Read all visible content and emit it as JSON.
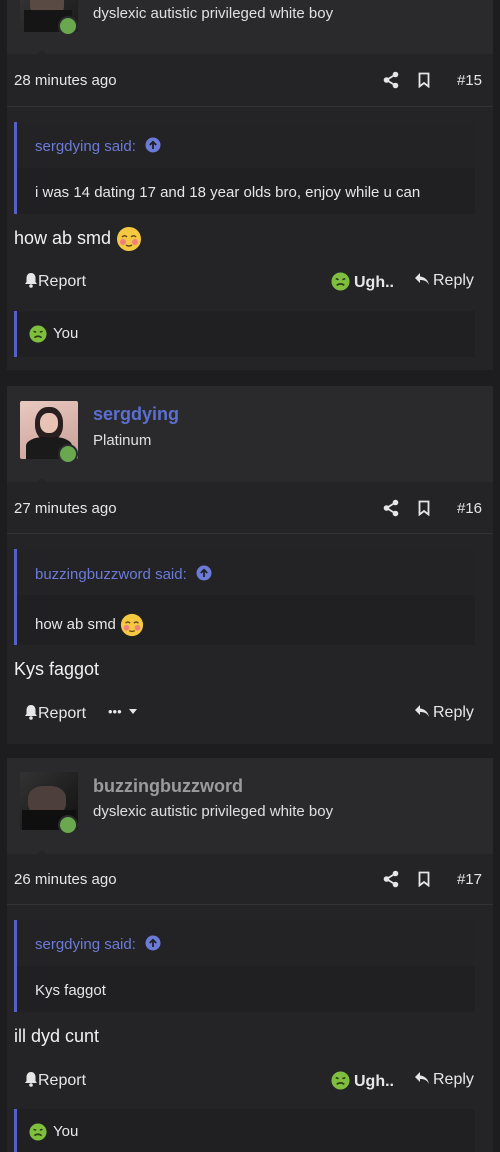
{
  "posts": [
    {
      "user_title": "dyslexic autistic privileged white boy",
      "time": "28 minutes ago",
      "number": "#15",
      "quote_author": "sergdying said:",
      "quote_text": "i was 14 dating 17 and 18 year olds bro, enjoy while u can",
      "message": "how ab smd",
      "report_label": "Report",
      "reaction_label": "Ugh..",
      "reply_label": "Reply",
      "reacted_by": "You"
    },
    {
      "username": "sergdying",
      "user_title": "Platinum",
      "time": "27 minutes ago",
      "number": "#16",
      "quote_author": "buzzingbuzzword said:",
      "quote_text": "how ab smd",
      "message": "Kys faggot",
      "report_label": "Report",
      "more_label": "•••",
      "reply_label": "Reply"
    },
    {
      "username": "buzzingbuzzword",
      "user_title": "dyslexic autistic privileged white boy",
      "time": "26 minutes ago",
      "number": "#17",
      "quote_author": "sergdying said:",
      "quote_text": "Kys faggot",
      "message": "ill dyd cunt",
      "report_label": "Report",
      "reaction_label": "Ugh..",
      "reply_label": "Reply",
      "reacted_by": "You"
    }
  ],
  "colors": {
    "accent": "#5561c6",
    "link": "#6b7bd7",
    "online": "#6aa84f",
    "username_sergdying": "#5c6fd0",
    "username_buzz": "#9b9b9b",
    "background": "#1d1d1f"
  },
  "icons": [
    "share-icon",
    "bookmark-icon",
    "arrow-up-circle-icon",
    "bell-icon",
    "reply-icon",
    "sick-face-icon",
    "blush-face-icon",
    "caret-down-icon"
  ]
}
